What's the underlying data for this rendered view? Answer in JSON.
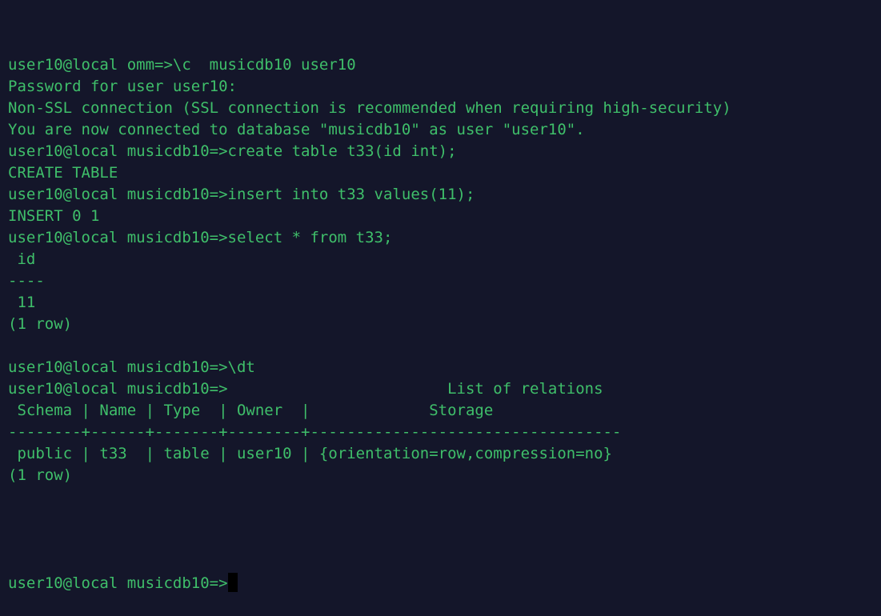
{
  "terminal": {
    "app": "openGauss gsql terminal",
    "colors": {
      "background": "#14162a",
      "foreground": "#3fbf6a",
      "cursor": "#000000"
    },
    "session": {
      "user": "user10",
      "host": "local",
      "initial_database": "omm",
      "connected_database": "musicdb10"
    },
    "lines": [
      "user10@local omm=>\\c  musicdb10 user10",
      "Password for user user10:",
      "Non-SSL connection (SSL connection is recommended when requiring high-security)",
      "You are now connected to database \"musicdb10\" as user \"user10\".",
      "user10@local musicdb10=>create table t33(id int);",
      "CREATE TABLE",
      "user10@local musicdb10=>insert into t33 values(11);",
      "INSERT 0 1",
      "user10@local musicdb10=>select * from t33;",
      " id",
      "----",
      " 11",
      "(1 row)",
      "",
      "user10@local musicdb10=>\\dt",
      "user10@local musicdb10=>                        List of relations",
      " Schema | Name | Type  | Owner  |             Storage",
      "--------+------+-------+--------+----------------------------------",
      " public | t33  | table | user10 | {orientation=row,compression=no}",
      "(1 row)",
      "",
      ""
    ],
    "prompt_final": "user10@local musicdb10=>",
    "commands": [
      "\\c  musicdb10 user10",
      "create table t33(id int);",
      "insert into t33 values(11);",
      "select * from t33;",
      "\\dt"
    ],
    "query_result": {
      "title": "",
      "columns": [
        "id"
      ],
      "rows": [
        [
          "11"
        ]
      ],
      "footer": "(1 row)"
    },
    "relations_result": {
      "title": "List of relations",
      "columns": [
        "Schema",
        "Name",
        "Type",
        "Owner",
        "Storage"
      ],
      "rows": [
        [
          "public",
          "t33",
          "table",
          "user10",
          "{orientation=row,compression=no}"
        ]
      ],
      "footer": "(1 row)"
    }
  }
}
